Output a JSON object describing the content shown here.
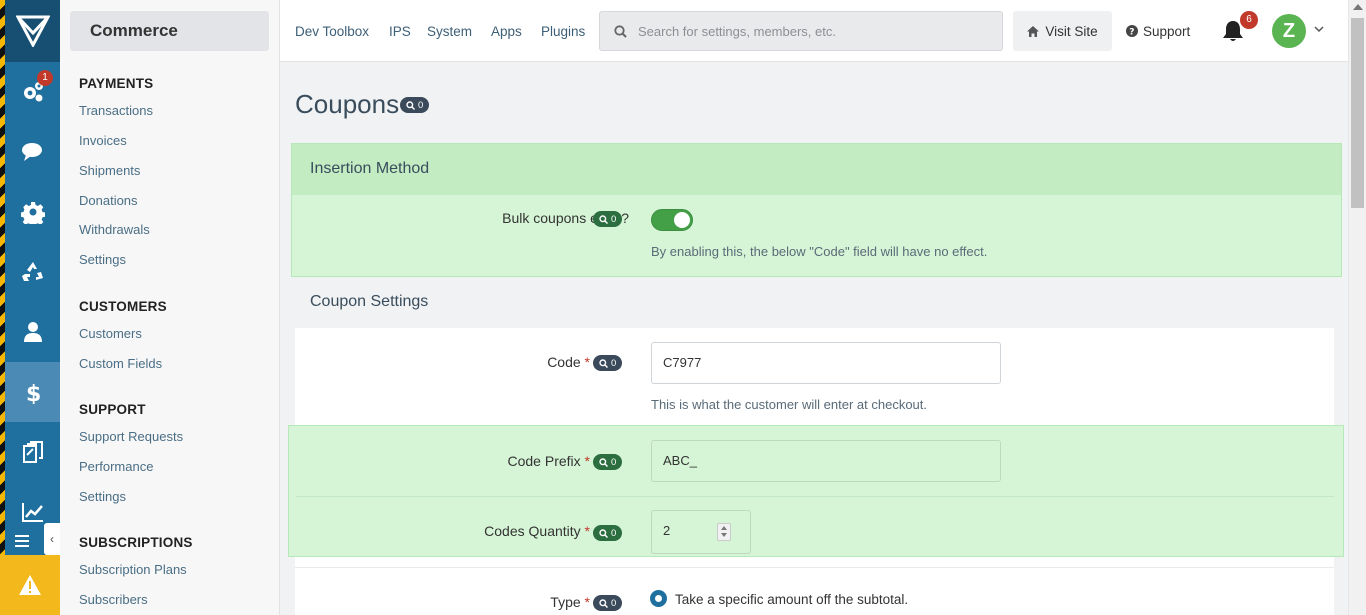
{
  "app_switcher": {
    "label": "Commerce"
  },
  "rail": {
    "items": [
      {
        "icon": "gears-icon",
        "badge": "1"
      },
      {
        "icon": "chat-icon"
      },
      {
        "icon": "gear-icon"
      },
      {
        "icon": "recycle-icon"
      },
      {
        "icon": "user-icon"
      },
      {
        "icon": "dollar-icon",
        "active": true
      },
      {
        "icon": "clipboard-icon"
      },
      {
        "icon": "chart-icon"
      }
    ]
  },
  "sidebar": {
    "groups": [
      {
        "title": "PAYMENTS",
        "items": [
          "Transactions",
          "Invoices",
          "Shipments",
          "Donations",
          "Withdrawals",
          "Settings"
        ]
      },
      {
        "title": "CUSTOMERS",
        "items": [
          "Customers",
          "Custom Fields"
        ]
      },
      {
        "title": "SUPPORT",
        "items": [
          "Support Requests",
          "Performance",
          "Settings"
        ]
      },
      {
        "title": "SUBSCRIPTIONS",
        "items": [
          "Subscription Plans",
          "Subscribers"
        ]
      }
    ]
  },
  "topbar": {
    "links": [
      "Dev Toolbox",
      "IPS",
      "System",
      "Apps",
      "Plugins"
    ],
    "search_placeholder": "Search for settings, members, etc.",
    "visit_site": "Visit Site",
    "support": "Support",
    "notifications_count": "6",
    "avatar_letter": "Z"
  },
  "page": {
    "title": "Coupons",
    "title_badge": "0",
    "insertion_section": {
      "title": "Insertion Method",
      "bulk_label": "Bulk coupons entry?",
      "bulk_badge": "0",
      "bulk_enabled": true,
      "bulk_desc": "By enabling this, the below \"Code\" field will have no effect."
    },
    "coupon_section": {
      "title": "Coupon Settings",
      "code_label": "Code",
      "code_badge": "0",
      "code_value": "C7977",
      "code_desc": "This is what the customer will enter at checkout.",
      "prefix_label": "Code Prefix",
      "prefix_badge": "0",
      "prefix_value": "ABC_",
      "quantity_label": "Codes Quantity",
      "quantity_badge": "0",
      "quantity_value": "2",
      "type_label": "Type",
      "type_badge": "0",
      "type_option": "Take a specific amount off the subtotal."
    },
    "required_mark": "*"
  },
  "colors": {
    "rail": "#1f6f9f",
    "rail_active": "#4b8ab4",
    "accent_green": "#43a047",
    "highlight": "#d6f5d6",
    "badge_red": "#c0392b"
  }
}
